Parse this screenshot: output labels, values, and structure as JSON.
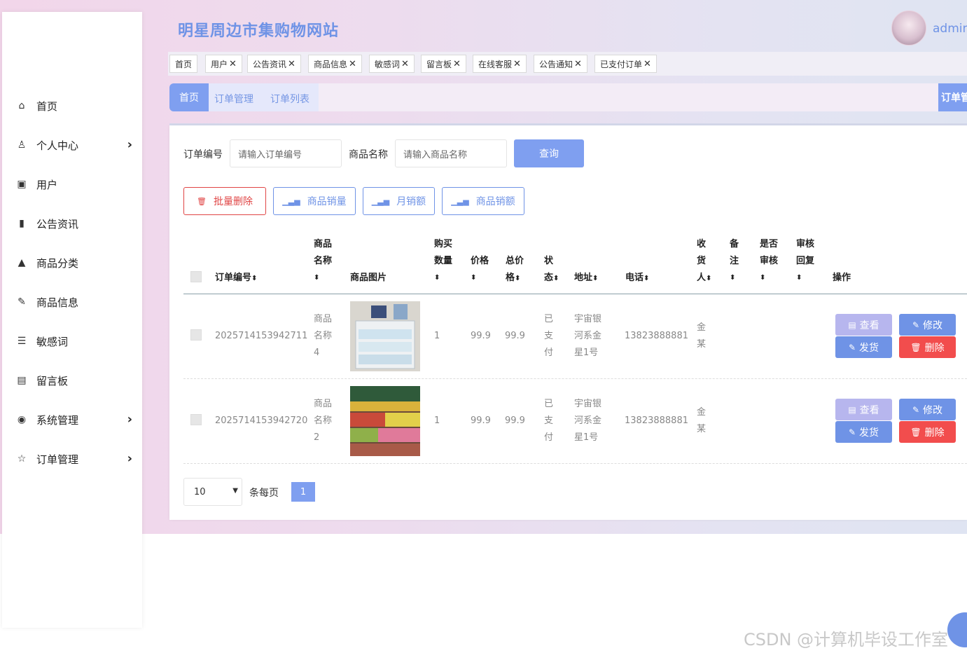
{
  "site": {
    "title": "明星周边市集购物网站",
    "user": "admin"
  },
  "sidebar": {
    "items": [
      {
        "label": "首页",
        "icon": "home-icon",
        "glyph": "⌂",
        "has_arrow": false
      },
      {
        "label": "个人中心",
        "icon": "user-icon",
        "glyph": "♙",
        "has_arrow": true
      },
      {
        "label": "用户",
        "icon": "users-icon",
        "glyph": "▣",
        "has_arrow": false
      },
      {
        "label": "公告资讯",
        "icon": "bar-chart-icon",
        "glyph": "▮",
        "has_arrow": false
      },
      {
        "label": "商品分类",
        "icon": "caret-up-icon",
        "glyph": "▲",
        "has_arrow": false
      },
      {
        "label": "商品信息",
        "icon": "edit-icon",
        "glyph": "✎",
        "has_arrow": false
      },
      {
        "label": "敏感词",
        "icon": "list-icon",
        "glyph": "☰",
        "has_arrow": false
      },
      {
        "label": "留言板",
        "icon": "board-icon",
        "glyph": "▤",
        "has_arrow": false
      },
      {
        "label": "系统管理",
        "icon": "eye-icon",
        "glyph": "◉",
        "has_arrow": true
      },
      {
        "label": "订单管理",
        "icon": "star-icon",
        "glyph": "☆",
        "has_arrow": true
      }
    ],
    "arrow": "›"
  },
  "tabs": [
    {
      "label": "首页",
      "closable": false
    },
    {
      "label": "用户",
      "closable": true
    },
    {
      "label": "公告资讯",
      "closable": true
    },
    {
      "label": "商品信息",
      "closable": true
    },
    {
      "label": "敏感词",
      "closable": true
    },
    {
      "label": "留言板",
      "closable": true
    },
    {
      "label": "在线客服",
      "closable": true
    },
    {
      "label": "公告通知",
      "closable": true
    },
    {
      "label": "已支付订单",
      "closable": true
    }
  ],
  "tab_close": "✕",
  "breadcrumb": {
    "home": "首页",
    "items": [
      "订单管理",
      "订单列表"
    ],
    "right_label": "订单管"
  },
  "search": {
    "order_no_label": "订单编号",
    "order_no_placeholder": "请输入订单编号",
    "product_label": "商品名称",
    "product_placeholder": "请输入商品名称",
    "query_button": "查询"
  },
  "actions": {
    "batch_delete": "批量删除",
    "product_sales": "商品销量",
    "monthly_sales": "月销额",
    "product_revenue": "商品销额"
  },
  "table": {
    "headers": {
      "order_no": "订单编号",
      "product_name": [
        "商品",
        "名称"
      ],
      "image": "商品图片",
      "quantity": [
        "购买",
        "数量"
      ],
      "price": "价格",
      "total": [
        "总价",
        "格"
      ],
      "status": [
        "状",
        "态"
      ],
      "address": "地址",
      "phone": "电话",
      "receiver": [
        "收",
        "货",
        "人"
      ],
      "remark": [
        "备",
        "注"
      ],
      "audited": [
        "是否",
        "审核"
      ],
      "reply": [
        "审核",
        "回复"
      ],
      "ops": "操作"
    },
    "sort_glyph": "⬍",
    "rows": [
      {
        "order_no": "2025714153942711",
        "product_name": [
          "商品",
          "名称",
          "4"
        ],
        "quantity": "1",
        "price": "99.9",
        "total": "99.9",
        "status": [
          "已",
          "支",
          "付"
        ],
        "address": [
          "宇宙银",
          "河系金",
          "星1号"
        ],
        "phone": "13823888881",
        "receiver": [
          "金",
          "某"
        ]
      },
      {
        "order_no": "2025714153942720",
        "product_name": [
          "商品",
          "名称",
          "2"
        ],
        "quantity": "1",
        "price": "99.9",
        "total": "99.9",
        "status": [
          "已",
          "支",
          "付"
        ],
        "address": [
          "宇宙银",
          "河系金",
          "星1号"
        ],
        "phone": "13823888881",
        "receiver": [
          "金",
          "某"
        ]
      }
    ],
    "row_buttons": {
      "view": "查看",
      "edit": "修改",
      "ship": "发货",
      "delete": "删除"
    }
  },
  "pagination": {
    "page_size": "10",
    "per_page_label": "条每页",
    "current_page": "1"
  },
  "watermark": "CSDN @计算机毕设工作室",
  "colors": {
    "accent": "#6f93e6",
    "danger": "#f24d4d",
    "view": "#b7b6ee"
  }
}
